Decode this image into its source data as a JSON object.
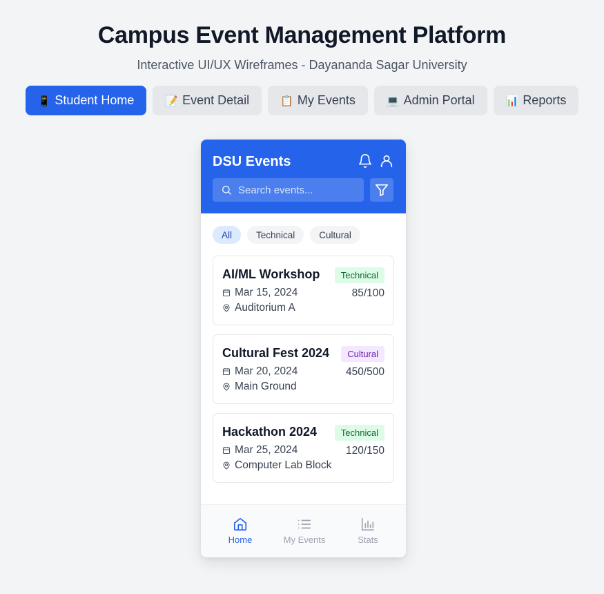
{
  "page": {
    "title": "Campus Event Management Platform",
    "subtitle": "Interactive UI/UX Wireframes - Dayananda Sagar University"
  },
  "nav": [
    {
      "emoji": "📱",
      "label": "Student Home",
      "active": true
    },
    {
      "emoji": "📝",
      "label": "Event Detail",
      "active": false
    },
    {
      "emoji": "📋",
      "label": "My Events",
      "active": false
    },
    {
      "emoji": "💻",
      "label": "Admin Portal",
      "active": false
    },
    {
      "emoji": "📊",
      "label": "Reports",
      "active": false
    }
  ],
  "app": {
    "title": "DSU Events",
    "search_placeholder": "Search events...",
    "header_icons": [
      "bell-icon",
      "user-icon",
      "filter-icon",
      "search-icon"
    ],
    "colors": {
      "primary": "#2563eb",
      "technical_bg": "#dcfce7",
      "cultural_bg": "#f3e8ff"
    }
  },
  "filters": {
    "chips": [
      {
        "label": "All",
        "active": true
      },
      {
        "label": "Technical",
        "active": false
      },
      {
        "label": "Cultural",
        "active": false
      }
    ]
  },
  "events": [
    {
      "name": "AI/ML Workshop",
      "category": "Technical",
      "date": "Mar 15, 2024",
      "location": "Auditorium A",
      "registered": "85/100"
    },
    {
      "name": "Cultural Fest 2024",
      "category": "Cultural",
      "date": "Mar 20, 2024",
      "location": "Main Ground",
      "registered": "450/500"
    },
    {
      "name": "Hackathon 2024",
      "category": "Technical",
      "date": "Mar 25, 2024",
      "location": "Computer Lab Block",
      "registered": "120/150"
    }
  ],
  "bottom_nav": {
    "tabs": [
      {
        "label": "Home",
        "icon": "home-icon",
        "active": true
      },
      {
        "label": "My Events",
        "icon": "list-icon",
        "active": false
      },
      {
        "label": "Stats",
        "icon": "bar-chart-icon",
        "active": false
      }
    ]
  }
}
